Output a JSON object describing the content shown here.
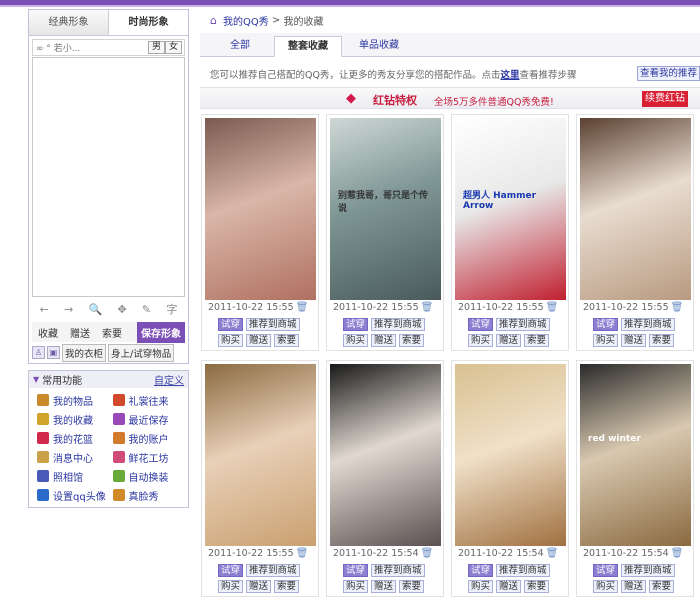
{
  "left_panel": {
    "tabs": [
      "经典形象",
      "时尚形象"
    ],
    "search_text": "∞ ° 若小...",
    "gender": [
      "男",
      "女"
    ],
    "tool_icons": [
      "←",
      "→",
      "🔍",
      "✥",
      "✎",
      "字"
    ],
    "actions": [
      "收藏",
      "赠送",
      "索要"
    ],
    "save_label": "保存形象",
    "wardrobe_label": "我的衣柜",
    "tryon_label": "身上/试穿物品"
  },
  "common": {
    "title": "常用功能",
    "edit_label": "自定义",
    "items": [
      {
        "label": "我的物品",
        "color": "#c98a2a"
      },
      {
        "label": "礼裳往来",
        "color": "#d04a2a"
      },
      {
        "label": "我的收藏",
        "color": "#d0a42a"
      },
      {
        "label": "最近保存",
        "color": "#9a4ab8"
      },
      {
        "label": "我的花篮",
        "color": "#d02a4a"
      },
      {
        "label": "我的账户",
        "color": "#d07a2a"
      },
      {
        "label": "消息中心",
        "color": "#c9a24a"
      },
      {
        "label": "鲜花工坊",
        "color": "#d04a7a"
      },
      {
        "label": "照相馆",
        "color": "#4a5ab8"
      },
      {
        "label": "自动换装",
        "color": "#6aaa3a"
      },
      {
        "label": "设置qq头像",
        "color": "#2a6ac8"
      },
      {
        "label": "真脸秀",
        "color": "#d08a2a"
      }
    ]
  },
  "breadcrumb": {
    "home": "我的QQ秀",
    "sep": ">",
    "current": "我的收藏"
  },
  "tabs": [
    "全部",
    "整套收藏",
    "单品收藏"
  ],
  "note": {
    "before": "您可以推荐自己搭配的QQ秀，让更多的秀友分享您的搭配作品。点击",
    "link": "这里",
    "after": "查看推荐步骤",
    "button": "查看我的推荐"
  },
  "promo": {
    "title": "红钻特权",
    "desc": "全场5万多件普通QQ秀免费!",
    "button": "续费红钻"
  },
  "buttons": {
    "try": "试穿",
    "recommend": "推荐到商城",
    "buy": "购买",
    "gift": "赠送",
    "ask": "索要"
  },
  "cards": [
    {
      "date": "2011-10-22 15:55",
      "palette": [
        "#7a5a50",
        "#d9b6a8",
        "#b07060"
      ]
    },
    {
      "date": "2011-10-22 15:55",
      "palette": [
        "#cfd8d6",
        "#7e9694",
        "#4a5a5c"
      ],
      "caption": "别惹我哥，哥只是个传说"
    },
    {
      "date": "2011-10-22 15:55",
      "palette": [
        "#ffffff",
        "#e8e8e8",
        "#c02030"
      ],
      "caption": "超男人 Hammer Arrow"
    },
    {
      "date": "2011-10-22 15:55",
      "palette": [
        "#5a4030",
        "#e8dcd0",
        "#b89a80"
      ]
    },
    {
      "date": "2011-10-22 15:55",
      "palette": [
        "#8a6a40",
        "#e8d0b8",
        "#caa070"
      ]
    },
    {
      "date": "2011-10-22 15:54",
      "palette": [
        "#1a1a1a",
        "#e0d8d0",
        "#5a5050"
      ]
    },
    {
      "date": "2011-10-22 15:54",
      "palette": [
        "#d8c090",
        "#f0e0c8",
        "#a07040"
      ]
    },
    {
      "date": "2011-10-22 15:54",
      "palette": [
        "#2a2a2a",
        "#d8c8b0",
        "#8a6a40"
      ],
      "caption": "red winter"
    }
  ]
}
